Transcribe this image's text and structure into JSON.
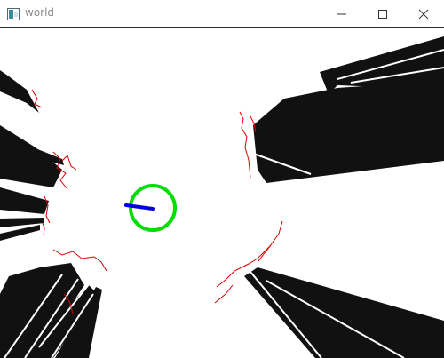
{
  "window": {
    "title": "world",
    "app_icon": "opencv-window-icon",
    "controls": [
      "minimize-icon",
      "maximize-icon",
      "close-icon"
    ]
  },
  "viewport": {
    "description_colors": {
      "background": "#ffffff",
      "walls": "#111111",
      "lidar_points": "#e00000",
      "robot_ring": "#00dd00",
      "heading_arrow": "#0000dd"
    }
  }
}
